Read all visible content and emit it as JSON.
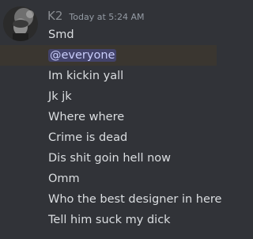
{
  "message": {
    "author": "K2",
    "timestamp": "Today at 5:24 AM",
    "lines": [
      {
        "text": "Smd",
        "highlight": false
      },
      {
        "text": "@everyone",
        "highlight": true,
        "mention": true
      },
      {
        "text": "Im kickin yall",
        "highlight": false
      },
      {
        "text": "Jk jk",
        "highlight": false
      },
      {
        "text": "Where where",
        "highlight": false
      },
      {
        "text": "Crime is dead",
        "highlight": false
      },
      {
        "text": "Dis shit goin hell now",
        "highlight": false
      },
      {
        "text": "Omm",
        "highlight": false
      },
      {
        "text": "Who the best designer in here",
        "highlight": false
      },
      {
        "text": "Tell him suck my dick",
        "highlight": false
      }
    ]
  },
  "colors": {
    "background": "#313338",
    "text": "#dbdee1",
    "username": "#8a8d92",
    "timestamp": "#949ba4",
    "mention_bg": "#5865f2",
    "highlight_row": "#3a3630"
  },
  "icons": {
    "avatar": "user-avatar-photo"
  }
}
